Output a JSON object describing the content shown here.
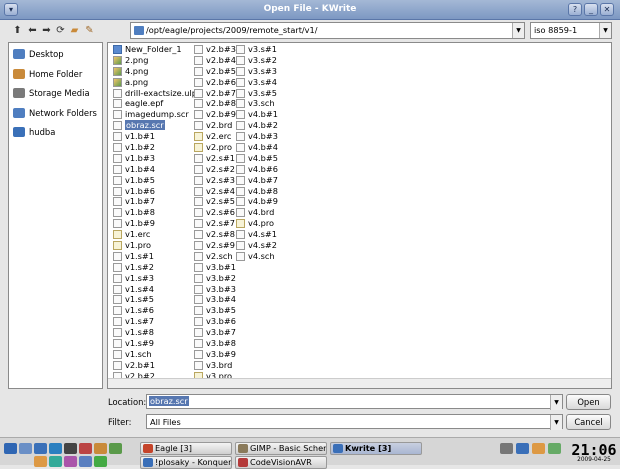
{
  "window": {
    "title": "Open File - KWrite"
  },
  "toolbar": {
    "path": "/opt/eagle/projects/2009/remote_start/v1/",
    "encoding": "iso 8859-1"
  },
  "sidebar": {
    "items": [
      {
        "label": "Desktop",
        "icon": "desktop-icon",
        "color": "#4f7ec0"
      },
      {
        "label": "Home Folder",
        "icon": "home-icon",
        "color": "#c98a3a"
      },
      {
        "label": "Storage Media",
        "icon": "drive-icon",
        "color": "#7a7a7a"
      },
      {
        "label": "Network Folders",
        "icon": "network-icon",
        "color": "#4f7ec0"
      },
      {
        "label": "hudba",
        "icon": "folder-icon",
        "color": "#3a70b8"
      }
    ]
  },
  "files": {
    "columns": [
      [
        {
          "name": "New_Folder_1",
          "type": "dir"
        },
        {
          "name": "2.png",
          "type": "img"
        },
        {
          "name": "4.png",
          "type": "img"
        },
        {
          "name": "a.png",
          "type": "img"
        },
        {
          "name": "drill-exactsize.ulp",
          "type": "doc"
        },
        {
          "name": "eagle.epf",
          "type": "doc"
        },
        {
          "name": "imagedump.scr",
          "type": "doc"
        },
        {
          "name": "obraz.scr",
          "type": "doc",
          "selected": true
        },
        {
          "name": "v1.b#1",
          "type": "doc"
        },
        {
          "name": "v1.b#2",
          "type": "doc"
        },
        {
          "name": "v1.b#3",
          "type": "doc"
        },
        {
          "name": "v1.b#4",
          "type": "doc"
        },
        {
          "name": "v1.b#5",
          "type": "doc"
        },
        {
          "name": "v1.b#6",
          "type": "doc"
        },
        {
          "name": "v1.b#7",
          "type": "doc"
        },
        {
          "name": "v1.b#8",
          "type": "doc"
        },
        {
          "name": "v1.b#9",
          "type": "doc"
        },
        {
          "name": "v1.erc",
          "type": "pen"
        },
        {
          "name": "v1.pro",
          "type": "pen"
        },
        {
          "name": "v1.s#1",
          "type": "doc"
        },
        {
          "name": "v1.s#2",
          "type": "doc"
        },
        {
          "name": "v1.s#3",
          "type": "doc"
        },
        {
          "name": "v1.s#4",
          "type": "doc"
        },
        {
          "name": "v1.s#5",
          "type": "doc"
        },
        {
          "name": "v1.s#6",
          "type": "doc"
        },
        {
          "name": "v1.s#7",
          "type": "doc"
        },
        {
          "name": "v1.s#8",
          "type": "doc"
        },
        {
          "name": "v1.s#9",
          "type": "doc"
        },
        {
          "name": "v1.sch",
          "type": "doc"
        },
        {
          "name": "v2.b#1",
          "type": "doc"
        },
        {
          "name": "v2.b#2",
          "type": "doc"
        }
      ],
      [
        {
          "name": "v2.b#3",
          "type": "doc"
        },
        {
          "name": "v2.b#4",
          "type": "doc"
        },
        {
          "name": "v2.b#5",
          "type": "doc"
        },
        {
          "name": "v2.b#6",
          "type": "doc"
        },
        {
          "name": "v2.b#7",
          "type": "doc"
        },
        {
          "name": "v2.b#8",
          "type": "doc"
        },
        {
          "name": "v2.b#9",
          "type": "doc"
        },
        {
          "name": "v2.brd",
          "type": "doc"
        },
        {
          "name": "v2.erc",
          "type": "pen"
        },
        {
          "name": "v2.pro",
          "type": "pen"
        },
        {
          "name": "v2.s#1",
          "type": "doc"
        },
        {
          "name": "v2.s#2",
          "type": "doc"
        },
        {
          "name": "v2.s#3",
          "type": "doc"
        },
        {
          "name": "v2.s#4",
          "type": "doc"
        },
        {
          "name": "v2.s#5",
          "type": "doc"
        },
        {
          "name": "v2.s#6",
          "type": "doc"
        },
        {
          "name": "v2.s#7",
          "type": "doc"
        },
        {
          "name": "v2.s#8",
          "type": "doc"
        },
        {
          "name": "v2.s#9",
          "type": "doc"
        },
        {
          "name": "v2.sch",
          "type": "doc"
        },
        {
          "name": "v3.b#1",
          "type": "doc"
        },
        {
          "name": "v3.b#2",
          "type": "doc"
        },
        {
          "name": "v3.b#3",
          "type": "doc"
        },
        {
          "name": "v3.b#4",
          "type": "doc"
        },
        {
          "name": "v3.b#5",
          "type": "doc"
        },
        {
          "name": "v3.b#6",
          "type": "doc"
        },
        {
          "name": "v3.b#7",
          "type": "doc"
        },
        {
          "name": "v3.b#8",
          "type": "doc"
        },
        {
          "name": "v3.b#9",
          "type": "doc"
        },
        {
          "name": "v3.brd",
          "type": "doc"
        },
        {
          "name": "v3.pro",
          "type": "pen"
        }
      ],
      [
        {
          "name": "v3.s#1",
          "type": "doc"
        },
        {
          "name": "v3.s#2",
          "type": "doc"
        },
        {
          "name": "v3.s#3",
          "type": "doc"
        },
        {
          "name": "v3.s#4",
          "type": "doc"
        },
        {
          "name": "v3.s#5",
          "type": "doc"
        },
        {
          "name": "v3.sch",
          "type": "doc"
        },
        {
          "name": "v4.b#1",
          "type": "doc"
        },
        {
          "name": "v4.b#2",
          "type": "doc"
        },
        {
          "name": "v4.b#3",
          "type": "doc"
        },
        {
          "name": "v4.b#4",
          "type": "doc"
        },
        {
          "name": "v4.b#5",
          "type": "doc"
        },
        {
          "name": "v4.b#6",
          "type": "doc"
        },
        {
          "name": "v4.b#7",
          "type": "doc"
        },
        {
          "name": "v4.b#8",
          "type": "doc"
        },
        {
          "name": "v4.b#9",
          "type": "doc"
        },
        {
          "name": "v4.brd",
          "type": "doc"
        },
        {
          "name": "v4.pro",
          "type": "pen"
        },
        {
          "name": "v4.s#1",
          "type": "doc"
        },
        {
          "name": "v4.s#2",
          "type": "doc"
        },
        {
          "name": "v4.sch",
          "type": "doc"
        }
      ]
    ]
  },
  "location": {
    "label": "Location:",
    "value": "obraz.scr"
  },
  "filter": {
    "label": "Filter:",
    "value": "All Files"
  },
  "buttons": {
    "open": "Open",
    "cancel": "Cancel"
  },
  "taskbar": {
    "tasks": [
      {
        "label": "Eagle [3]",
        "color": "#c5442a",
        "active": false
      },
      {
        "label": "GIMP - Basic Schem",
        "color": "#8a7a5a",
        "active": false
      },
      {
        "label": "Kwrite [3]",
        "color": "#3a6fb8",
        "active": true
      },
      {
        "label": "!plosaky - Konqueror",
        "color": "#3a6fb8",
        "active": false
      },
      {
        "label": "CodeVisionAVR",
        "color": "#b43a3a",
        "active": false
      }
    ],
    "clock": "21:06",
    "date": "2009-04-25"
  }
}
